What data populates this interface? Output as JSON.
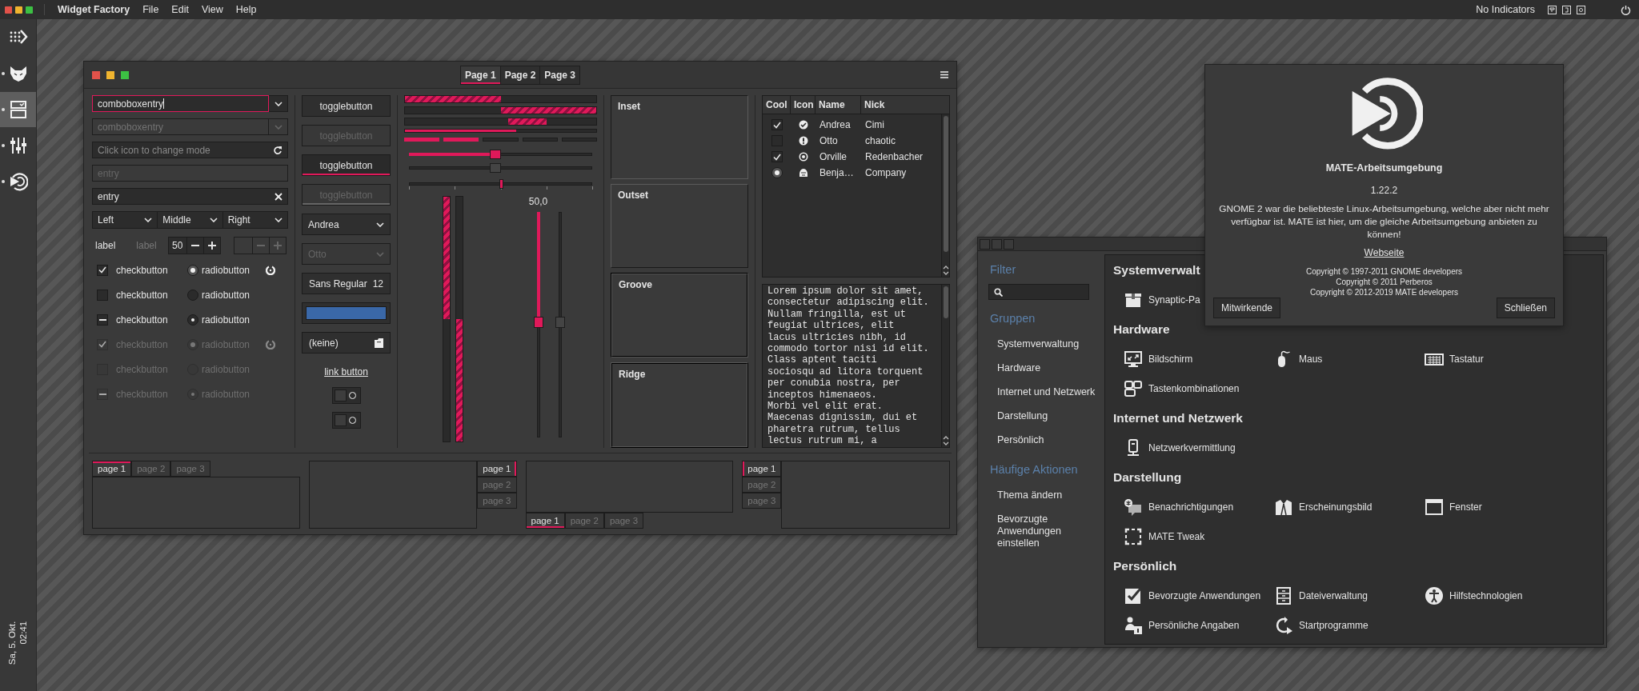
{
  "top_bar": {
    "app_name": "Widget Factory",
    "menus": [
      "File",
      "Edit",
      "View",
      "Help"
    ],
    "indicator_label": "No Indicators"
  },
  "dock": {
    "items": [
      {
        "kind": "apps",
        "selected": false,
        "running": false
      },
      {
        "kind": "cat",
        "selected": false,
        "running": true
      },
      {
        "kind": "form",
        "selected": true,
        "running": true
      },
      {
        "kind": "sliders",
        "selected": false,
        "running": true
      },
      {
        "kind": "logo",
        "selected": false,
        "running": true
      }
    ],
    "date": "Sa, 5. Okt.",
    "time": "02:41"
  },
  "widget_factory": {
    "stack_switcher": [
      {
        "label": "Page 1",
        "selected": true
      },
      {
        "label": "Page 2",
        "selected": false
      },
      {
        "label": "Page 3",
        "selected": false
      }
    ],
    "entries": [
      {
        "kind": "combo",
        "value": "comboboxentry",
        "focused": true,
        "disabled": false
      },
      {
        "kind": "combo",
        "value": "comboboxentry",
        "focused": false,
        "disabled": true
      },
      {
        "kind": "icon",
        "placeholder": "Click icon to change mode",
        "focused": false,
        "disabled": false
      },
      {
        "kind": "plain",
        "placeholder": "entry",
        "focused": false,
        "disabled": true
      },
      {
        "kind": "clear",
        "value": "entry",
        "focused": false,
        "disabled": false
      }
    ],
    "linked_combos": [
      "Left",
      "Middle",
      "Right"
    ],
    "labels": [
      {
        "text": "label",
        "disabled": false
      },
      {
        "text": "label",
        "disabled": true
      }
    ],
    "spin_buttons": [
      {
        "value": "50",
        "disabled": false
      },
      {
        "disabled": true
      }
    ],
    "check_rows": [
      {
        "check": {
          "label": "checkbutton",
          "checked": true,
          "inconsistent": false
        },
        "radio": {
          "label": "radiobutton",
          "checked": true,
          "inconsistent": false
        },
        "disabled": false,
        "spinner": true
      },
      {
        "check": {
          "label": "checkbutton",
          "checked": false,
          "inconsistent": false
        },
        "radio": {
          "label": "radiobutton",
          "checked": false,
          "inconsistent": false
        },
        "disabled": false,
        "spinner": false
      },
      {
        "check": {
          "label": "checkbutton",
          "inconsistent": true
        },
        "radio": {
          "label": "radiobutton",
          "inconsistent": true
        },
        "disabled": false,
        "spinner": false
      },
      {
        "check": {
          "label": "checkbutton",
          "checked": true,
          "inconsistent": false
        },
        "radio": {
          "label": "radiobutton",
          "checked": true,
          "inconsistent": false
        },
        "disabled": true,
        "spinner": true
      },
      {
        "check": {
          "label": "checkbutton",
          "checked": false,
          "inconsistent": false
        },
        "radio": {
          "label": "radiobutton",
          "checked": false,
          "inconsistent": false
        },
        "disabled": true,
        "spinner": false
      },
      {
        "check": {
          "label": "checkbutton",
          "inconsistent": true
        },
        "radio": {
          "label": "radiobutton",
          "inconsistent": true
        },
        "disabled": true,
        "spinner": false
      }
    ],
    "toggle_buttons": [
      {
        "label": "togglebutton",
        "active": false,
        "disabled": false
      },
      {
        "label": "togglebutton",
        "active": false,
        "disabled": true
      },
      {
        "label": "togglebutton",
        "active": true,
        "disabled": false
      },
      {
        "label": "togglebutton",
        "active": true,
        "disabled": true
      }
    ],
    "combos": [
      {
        "value": "Andrea",
        "disabled": false
      },
      {
        "value": "Otto",
        "disabled": true
      }
    ],
    "font_button": {
      "family": "Sans Regular",
      "size": "12"
    },
    "color_button": {
      "color": "#3a68a8"
    },
    "file_button": {
      "label": "(keine)"
    },
    "link_button": "link button",
    "switches": [
      {
        "on": false
      },
      {
        "on": false
      }
    ],
    "progress_bars": [
      {
        "kind": "bar",
        "level": 0.5,
        "inverted": false
      },
      {
        "kind": "bar",
        "level": 0.5,
        "inverted": true
      },
      {
        "kind": "pulse"
      },
      {
        "kind": "thin",
        "level": 0.58,
        "inverted": false
      }
    ],
    "level_bar": {
      "level": 0.4
    },
    "sliders": [
      {
        "kind": "plain",
        "level": 0.47,
        "disabled": false
      },
      {
        "kind": "plain",
        "level": 0.47,
        "disabled": true
      },
      {
        "kind": "marks",
        "level": 0.5,
        "disabled": false
      }
    ],
    "vertical_bars": [
      {
        "level": 0.5,
        "inverted": false
      },
      {
        "level": 0.5,
        "inverted": true
      }
    ],
    "vertical_scales": [
      {
        "value_label": "50,0",
        "level": 0.49,
        "disabled": false
      },
      {
        "level": 0.49,
        "disabled": true
      }
    ],
    "frames": [
      {
        "label": "Inset",
        "kind": "inset"
      },
      {
        "label": "Outset",
        "kind": "outset"
      },
      {
        "label": "Groove",
        "kind": "groove"
      },
      {
        "label": "Ridge",
        "kind": "ridge"
      }
    ],
    "tree": {
      "columns": [
        "Cool",
        "Icon",
        "Name",
        "Nick"
      ],
      "rows": [
        {
          "kind": "check",
          "cool": {
            "kind": "check",
            "checked": true
          },
          "name": "Andrea",
          "nick": "Cimi"
        },
        {
          "kind": "warning",
          "cool": {
            "kind": "check",
            "checked": false
          },
          "name": "Otto",
          "nick": "chaotic"
        },
        {
          "kind": "ring",
          "cool": {
            "kind": "check",
            "checked": true
          },
          "name": "Orville",
          "nick": "Redenbacher"
        },
        {
          "kind": "emblem",
          "cool": {
            "kind": "radio",
            "checked": true
          },
          "name": "Benja…",
          "nick": "Company"
        }
      ]
    },
    "text_view": {
      "lines": [
        "Lorem ipsum dolor sit amet,",
        "consectetur adipiscing elit.",
        "Nullam fringilla, est ut",
        "feugiat ultrices, elit",
        "lacus ultricies nibh, id",
        "commodo tortor nisi id elit.",
        "Class aptent taciti",
        "sociosqu ad litora torquent",
        "per conubia nostra, per",
        "inceptos himenaeos.",
        "Morbi vel elit erat.",
        "Maecenas dignissim, dui et",
        "pharetra rutrum, tellus",
        "lectus rutrum mi, a"
      ]
    },
    "notebooks": [
      {
        "kind": "top",
        "tabs": [
          {
            "label": "page 1",
            "selected": true
          },
          {
            "label": "page 2",
            "selected": false
          },
          {
            "label": "page 3",
            "selected": false
          }
        ]
      },
      {
        "kind": "right",
        "tabs": [
          {
            "label": "page 1",
            "selected": true
          },
          {
            "label": "page 2",
            "selected": false
          },
          {
            "label": "page 3",
            "selected": false
          }
        ]
      },
      {
        "kind": "bottom",
        "tabs": [
          {
            "label": "page 1",
            "selected": true
          },
          {
            "label": "page 2",
            "selected": false
          },
          {
            "label": "page 3",
            "selected": false
          }
        ]
      },
      {
        "kind": "left",
        "tabs": [
          {
            "label": "page 1",
            "selected": true
          },
          {
            "label": "page 2",
            "selected": false
          },
          {
            "label": "page 3",
            "selected": false
          }
        ]
      }
    ]
  },
  "control_center": {
    "filter_heading": "Filter",
    "groups_heading": "Gruppen",
    "groups": [
      "Systemverwaltung",
      "Hardware",
      "Internet und Netzwerk",
      "Darstellung",
      "Persönlich"
    ],
    "actions_heading": "Häufige Aktionen",
    "actions": [
      "Thema ändern",
      "Bevorzugte Anwendungen einstellen"
    ],
    "sections": [
      {
        "title": "Systemverwalt",
        "items": [
          {
            "label": "Synaptic-Pa",
            "kind": "package"
          }
        ]
      },
      {
        "title": "Hardware",
        "items": [
          {
            "label": "Bildschirm",
            "kind": "display"
          },
          {
            "label": "Maus",
            "kind": "mouse"
          },
          {
            "label": "Tastatur",
            "kind": "keyboard"
          },
          {
            "label": "Tastenkombinationen",
            "kind": "shortcuts"
          }
        ]
      },
      {
        "title": "Internet und Netzwerk",
        "items": [
          {
            "label": "Netzwerkvermittlung",
            "kind": "device"
          }
        ]
      },
      {
        "title": "Darstellung",
        "items": [
          {
            "label": "Benachrichtigungen",
            "kind": "bubble"
          },
          {
            "label": "Erscheinungsbild",
            "kind": "tuxedo"
          },
          {
            "label": "Fenster",
            "kind": "window"
          },
          {
            "label": "MATE Tweak",
            "kind": "frame"
          }
        ]
      },
      {
        "title": "Persönlich",
        "items": [
          {
            "label": "Bevorzugte Anwendungen",
            "kind": "checkmark"
          },
          {
            "label": "Dateiverwaltung",
            "kind": "cabinet"
          },
          {
            "label": "Hilfstechnologien",
            "kind": "accessibility"
          },
          {
            "label": "Persönliche Angaben",
            "kind": "person"
          },
          {
            "label": "Startprogramme",
            "kind": "startup"
          }
        ]
      }
    ]
  },
  "about_dialog": {
    "title": "MATE-Arbeitsumgebung",
    "version": "1.22.2",
    "description": "GNOME 2 war die beliebteste Linux-Arbeitsumgebung, welche aber nicht mehr verfügbar ist. MATE ist hier, um die gleiche Arbeitsumgebung anbieten zu können!",
    "link": "Webseite",
    "copyright": [
      "Copyright © 1997-2011 GNOME developers",
      "Copyright © 2011 Perberos",
      "Copyright © 2012-2019 MATE developers"
    ],
    "buttons": [
      "Mitwirkende",
      "Schließen"
    ]
  }
}
